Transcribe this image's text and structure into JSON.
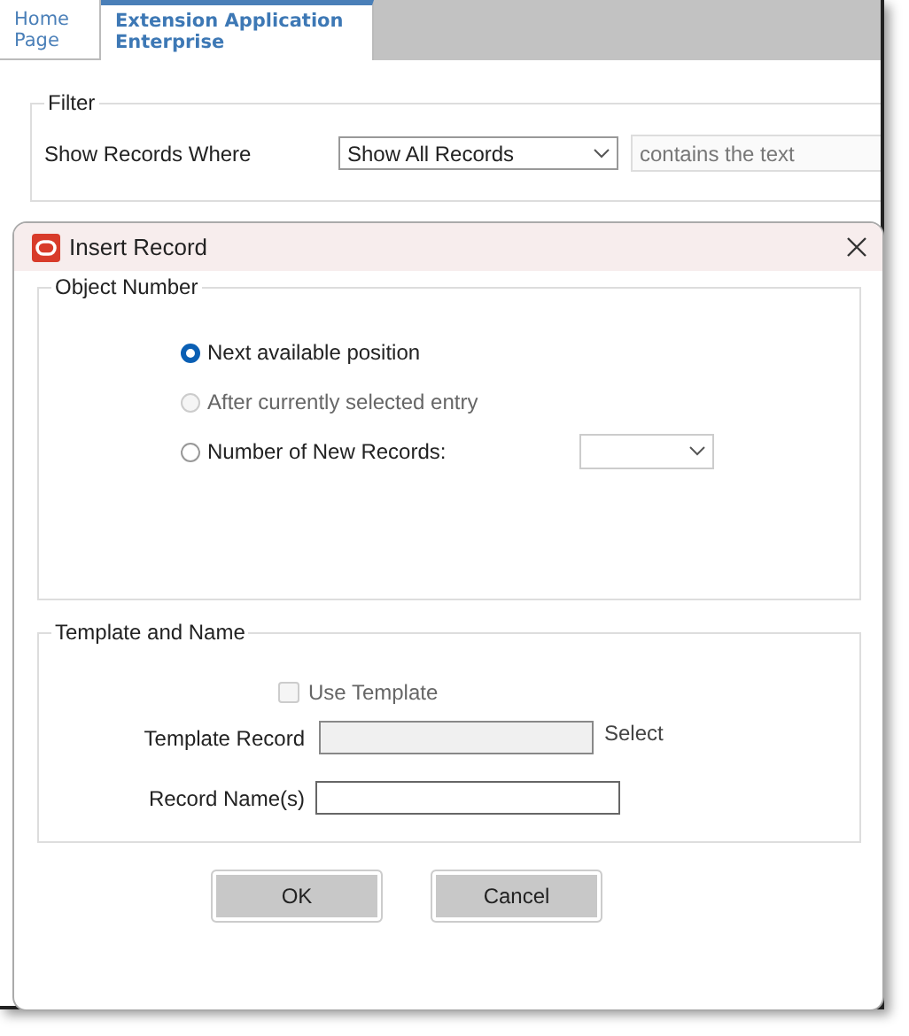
{
  "tabs": [
    {
      "label": "Home Page",
      "selected": false
    },
    {
      "label": "Extension Application Enterprise",
      "selected": true
    }
  ],
  "filter": {
    "title": "Filter",
    "label": "Show Records Where",
    "dropdown": {
      "value": "Show All Records"
    },
    "condition_field": {
      "value": "contains the text",
      "disabled": true
    }
  },
  "dialog": {
    "title": "Insert Record",
    "object_number": {
      "title": "Object Number",
      "options": [
        {
          "label": "Next available position",
          "selected": true,
          "disabled": false
        },
        {
          "label": "After currently selected entry",
          "selected": false,
          "disabled": true
        },
        {
          "label": "Number of New Records:",
          "selected": false,
          "disabled": false
        }
      ]
    },
    "template": {
      "title": "Template and Name",
      "use_template": {
        "label": "Use Template",
        "checked": false,
        "disabled": true
      },
      "template_record": {
        "label": "Template Record",
        "disabled": true
      },
      "select_link": "Select",
      "record_names": {
        "label": "Record Name(s)",
        "disabled": false
      }
    },
    "buttons": [
      "OK",
      "Cancel"
    ]
  }
}
